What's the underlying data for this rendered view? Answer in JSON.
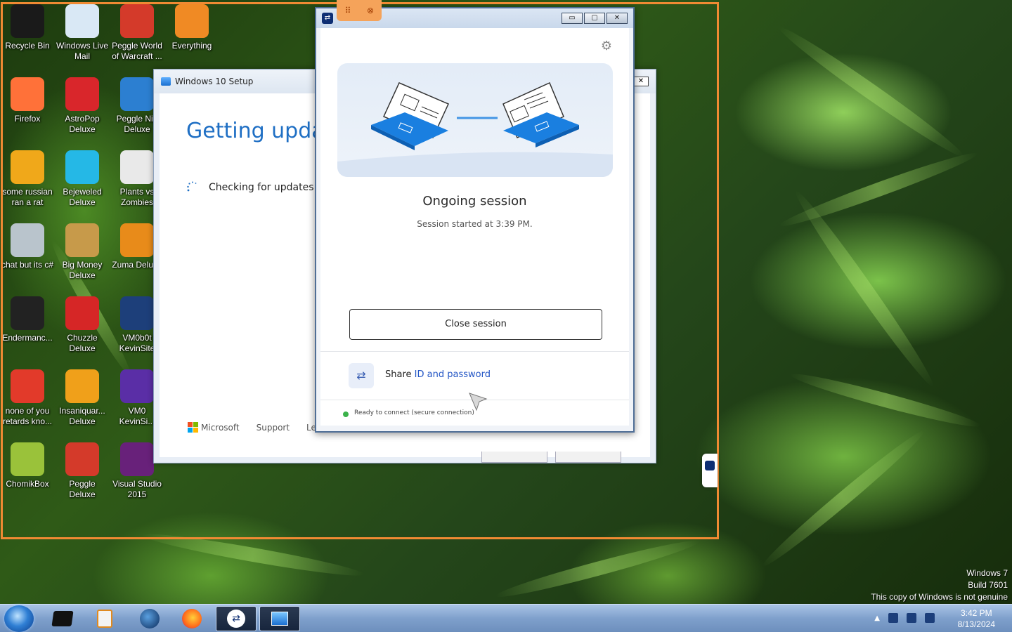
{
  "desktop": {
    "icons": [
      {
        "label": "Recycle Bin",
        "icon": "recycle-bin-icon",
        "color": "#1a1a1a"
      },
      {
        "label": "Windows Live Mail",
        "icon": "mail-icon",
        "color": "#d9e8f5"
      },
      {
        "label": "Peggle World of Warcraft ...",
        "icon": "peggle-icon",
        "color": "#d43a2a"
      },
      {
        "label": "Everything",
        "icon": "search-icon",
        "color": "#f08a24"
      },
      {
        "label": "Firefox",
        "icon": "firefox-icon",
        "color": "#ff7139"
      },
      {
        "label": "AstroPop Deluxe",
        "icon": "astropop-icon",
        "color": "#d9262b"
      },
      {
        "label": "Peggle Nig Deluxe",
        "icon": "peggle-nights-icon",
        "color": "#2c7fd1"
      },
      {
        "label": "some russian ran a rat",
        "icon": "de-icon",
        "color": "#f0a81a"
      },
      {
        "label": "Bejeweled Deluxe",
        "icon": "gem-icon",
        "color": "#25b8e6"
      },
      {
        "label": "Plants vs Zombies",
        "icon": "plant-icon",
        "color": "#e9e9e9"
      },
      {
        "label": "chat but its c#",
        "icon": "windows-stack-icon",
        "color": "#b9c4cc"
      },
      {
        "label": "Big Money Deluxe",
        "icon": "money-bag-icon",
        "color": "#c79a4a"
      },
      {
        "label": "Zuma Deluxe",
        "icon": "zuma-icon",
        "color": "#e88b1a"
      },
      {
        "label": "Endermanc...",
        "icon": "terminal-icon",
        "color": "#222222"
      },
      {
        "label": "Chuzzle Deluxe",
        "icon": "chuzzle-icon",
        "color": "#d62626"
      },
      {
        "label": "VM0b0t KevinSite",
        "icon": "vm-icon",
        "color": "#1d3f7a"
      },
      {
        "label": "none of you retards kno...",
        "icon": "red-app-icon",
        "color": "#e23a2a"
      },
      {
        "label": "Insaniquar... Deluxe",
        "icon": "fish-icon",
        "color": "#f0a01a"
      },
      {
        "label": "VM0 KevinSi...",
        "icon": "firefox-purple-icon",
        "color": "#5a2ea6"
      },
      {
        "label": "ChomikBox",
        "icon": "chomikbox-icon",
        "color": "#9ac23a"
      },
      {
        "label": "Peggle Deluxe",
        "icon": "peggle-deluxe-icon",
        "color": "#d43a2a"
      },
      {
        "label": "Visual Studio 2015",
        "icon": "visual-studio-icon",
        "color": "#68217a"
      }
    ]
  },
  "setup_window": {
    "title": "Windows 10 Setup",
    "heading": "Getting updat",
    "status": "Checking for updates",
    "footer": {
      "brand": "Microsoft",
      "support": "Support",
      "legal": "Le"
    }
  },
  "teamviewer": {
    "title_logo": "TV",
    "heading": "Ongoing session",
    "subtitle": "Session started at 3:39 PM.",
    "close_button": "Close session",
    "share_prefix": "Share ",
    "share_link": "ID and password",
    "status": "Ready to connect (secure connection)",
    "accent": "#2456c5",
    "status_color": "#3bb24a"
  },
  "remote_tab": {
    "grip": "⠿",
    "close": "⊗"
  },
  "watermark": {
    "line1": "Windows 7",
    "line2": "Build 7601",
    "line3": "This copy of Windows is not genuine"
  },
  "taskbar": {
    "clock_time": "3:42 PM",
    "clock_date": "8/13/2024"
  }
}
